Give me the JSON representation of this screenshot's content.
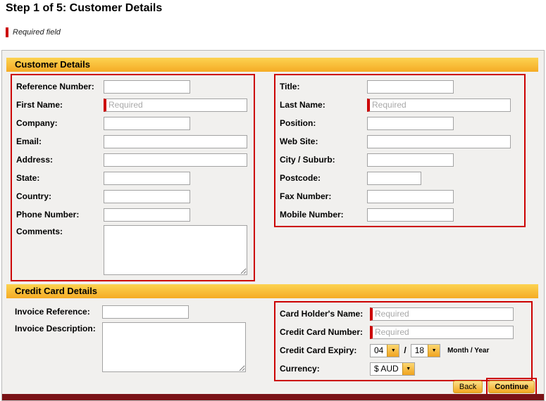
{
  "page": {
    "title": "Step 1 of 5: Customer Details",
    "required_note": "Required field"
  },
  "customer": {
    "heading": "Customer Details",
    "left": [
      {
        "label": "Reference Number:"
      },
      {
        "label": "First Name:",
        "placeholder": "Required"
      },
      {
        "label": "Company:"
      },
      {
        "label": "Email:"
      },
      {
        "label": "Address:"
      },
      {
        "label": "State:"
      },
      {
        "label": "Country:"
      },
      {
        "label": "Phone Number:"
      },
      {
        "label": "Comments:"
      }
    ],
    "right": [
      {
        "label": "Title:"
      },
      {
        "label": "Last Name:",
        "placeholder": "Required"
      },
      {
        "label": "Position:"
      },
      {
        "label": "Web Site:"
      },
      {
        "label": "City / Suburb:"
      },
      {
        "label": "Postcode:"
      },
      {
        "label": "Fax Number:"
      },
      {
        "label": "Mobile Number:"
      }
    ]
  },
  "credit": {
    "heading": "Credit Card Details",
    "left": [
      {
        "label": "Invoice Reference:"
      },
      {
        "label": "Invoice Description:"
      }
    ],
    "right": {
      "card_holder": {
        "label": "Card Holder's Name:",
        "placeholder": "Required"
      },
      "card_number": {
        "label": "Credit Card Number:",
        "placeholder": "Required"
      },
      "expiry": {
        "label": "Credit Card Expiry:",
        "month": "04",
        "separator": "/",
        "year": "18",
        "suffix": "Month / Year"
      },
      "currency": {
        "label": "Currency:",
        "value": "$ AUD"
      }
    }
  },
  "buttons": {
    "back": "Back",
    "continue": "Continue"
  }
}
